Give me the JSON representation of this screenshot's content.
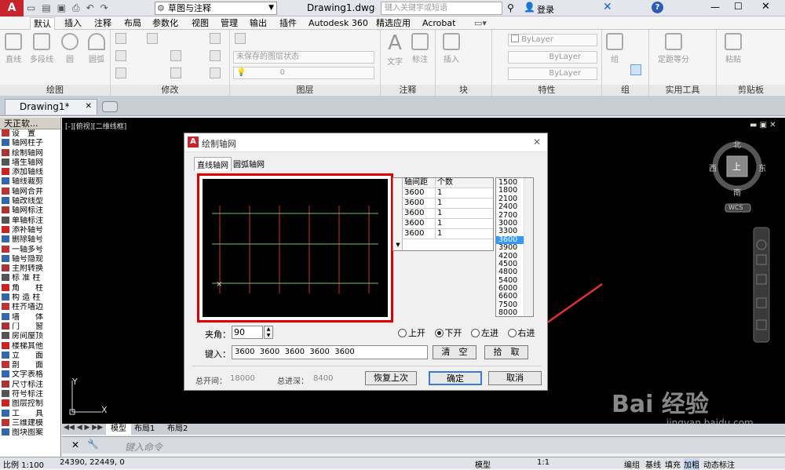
{
  "titlebar": {
    "workspace": "草图与注释",
    "doc_title": "Drawing1.dwg",
    "search_placeholder": "键入关键字或短语",
    "login": "登录"
  },
  "ribbon_tabs": [
    "默认",
    "插入",
    "注释",
    "布局",
    "参数化",
    "视图",
    "管理",
    "输出",
    "插件",
    "Autodesk 360",
    "精选应用",
    "Acrobat"
  ],
  "ribbon": {
    "draw": {
      "title": "绘图",
      "items": [
        "直线",
        "多段线",
        "圆",
        "圆弧"
      ]
    },
    "modify": {
      "title": "修改"
    },
    "layers": {
      "title": "图层",
      "state": "未保存的图层状态",
      "current": "0"
    },
    "annotation": {
      "title": "注释",
      "text": "文字",
      "dim": "标注"
    },
    "block": {
      "title": "块",
      "insert": "插入"
    },
    "properties": {
      "title": "特性",
      "color": "ByLayer",
      "linetype": "ByLayer",
      "lineweight": "ByLayer"
    },
    "groups": {
      "title": "组",
      "group": "组"
    },
    "utilities": {
      "title": "实用工具",
      "measure": "定距等分"
    },
    "clipboard": {
      "title": "剪贴板",
      "paste": "粘贴"
    }
  },
  "doc_tab": "Drawing1*",
  "sidebar": {
    "title": "天正软...",
    "items": [
      "设　置",
      "轴网柱子",
      "绘制轴网",
      "墙生轴网",
      "添加轴线",
      "轴线裁剪",
      "轴网合并",
      "轴改线型",
      "轴网标注",
      "单轴标注",
      "添补轴号",
      "删除轴号",
      "一轴多号",
      "轴号隐现",
      "主附转换",
      "标 准 柱",
      "角　　柱",
      "构 造 柱",
      "柱齐墙边",
      "墙　　体",
      "门　　窗",
      "房间屋顶",
      "楼梯其他",
      "立　　面",
      "剖　　面",
      "文字表格",
      "尺寸标注",
      "符号标注",
      "图层控制",
      "工　　具",
      "三维建模",
      "图块图案"
    ]
  },
  "canvas": {
    "view_label": "[-][俯视][二维线框]",
    "ucs_x": "X",
    "ucs_y": "Y"
  },
  "viewcube": {
    "north": "北",
    "south": "南",
    "east": "东",
    "west": "西",
    "top": "上",
    "wcs": "WCS"
  },
  "layout_tabs": [
    "模型",
    "布局1",
    "布局2"
  ],
  "command": {
    "placeholder": "键入命令"
  },
  "status": {
    "scale": "比例 1:100",
    "coords": "24390, 22449, 0",
    "items": [
      "模型",
      "1:1",
      "编组",
      "基线",
      "填充",
      "加粗",
      "动态标注"
    ]
  },
  "dialog": {
    "title": "绘制轴网",
    "tabs": [
      "直线轴网",
      "圆弧轴网"
    ],
    "grid_headers": [
      "轴间距",
      "个数"
    ],
    "grid_rows": [
      [
        "3600",
        "1"
      ],
      [
        "3600",
        "1"
      ],
      [
        "3600",
        "1"
      ],
      [
        "3600",
        "1"
      ],
      [
        "3600",
        "1"
      ]
    ],
    "spacing_list": [
      "1500",
      "1800",
      "2100",
      "2400",
      "2700",
      "3000",
      "3300",
      "3600",
      "3900",
      "4200",
      "4500",
      "4800",
      "5400",
      "6000",
      "6600",
      "7500",
      "8000"
    ],
    "selected_spacing": "3600",
    "radios": [
      "上开",
      "下开",
      "左进",
      "右进"
    ],
    "selected_radio": "下开",
    "angle_label": "夹角：",
    "angle_value": "90",
    "input_label": "键入：",
    "input_value": "3600  3600  3600  3600  3600",
    "clear_button": "清　空",
    "pick_button": "拾　取",
    "total_width_label": "总开间：",
    "total_width": "18000",
    "total_depth_label": "总进深：",
    "total_depth": "8400",
    "restore_button": "恢复上次",
    "ok_button": "确定",
    "cancel_button": "取消"
  },
  "watermark": {
    "brand": "Bai 经验",
    "url": "jingyan.baidu.com"
  },
  "colors": {
    "canvas": "#000000",
    "highlight": "#e00000",
    "axis_red": "#c83030",
    "axis_green": "#6cc46c",
    "selection": "#3399ff"
  }
}
